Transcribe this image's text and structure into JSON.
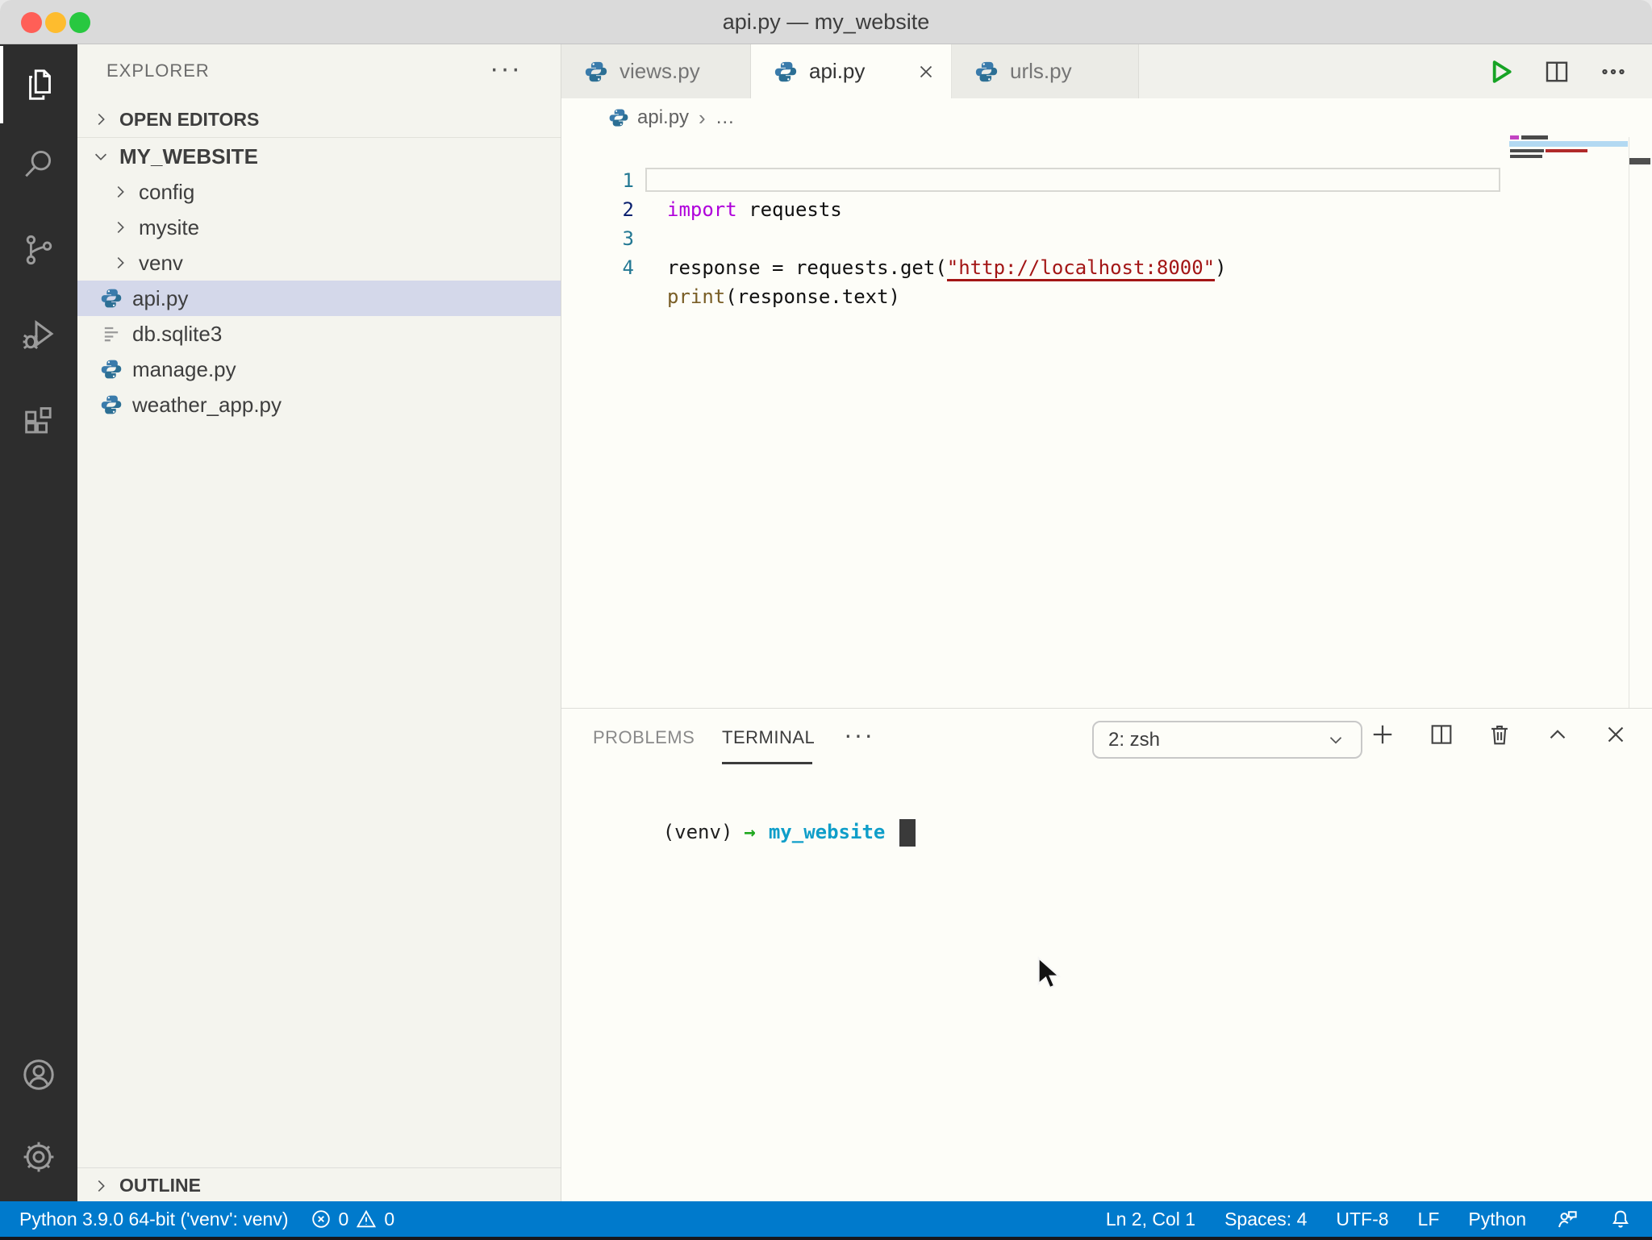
{
  "window": {
    "title": "api.py — my_website"
  },
  "colors": {
    "status_bar": "#007acc",
    "activity_bar": "#2d2d2d",
    "sidebar_bg": "#f4f4ee",
    "selection_bg": "#d4d8ea",
    "keyword": "#af00db",
    "string": "#a31515",
    "function": "#795e26",
    "line_number": "#237893",
    "active_line_number": "#0b216f",
    "terminal_cwd": "#0f9ec9",
    "terminal_arrow": "#1fa81f",
    "run_button": "#16a324"
  },
  "activity_bar": {
    "icons": [
      "files-icon",
      "search-icon",
      "source-control-icon",
      "run-debug-icon",
      "extensions-icon",
      "account-icon",
      "settings-gear-icon"
    ]
  },
  "sidebar": {
    "title": "EXPLORER",
    "more_label": "···",
    "open_editors_label": "OPEN EDITORS",
    "root_label": "MY_WEBSITE",
    "outline_label": "OUTLINE",
    "tree": [
      {
        "label": "config",
        "type": "folder"
      },
      {
        "label": "mysite",
        "type": "folder"
      },
      {
        "label": "venv",
        "type": "folder"
      },
      {
        "label": "api.py",
        "type": "python-file",
        "selected": true
      },
      {
        "label": "db.sqlite3",
        "type": "file"
      },
      {
        "label": "manage.py",
        "type": "python-file"
      },
      {
        "label": "weather_app.py",
        "type": "python-file"
      }
    ]
  },
  "editor_tabs": [
    {
      "label": "views.py",
      "active": false
    },
    {
      "label": "api.py",
      "active": true
    },
    {
      "label": "urls.py",
      "active": false
    }
  ],
  "breadcrumb": {
    "file": "api.py",
    "separator": "›",
    "more": "…"
  },
  "editor": {
    "lines": [
      {
        "num": "1",
        "tokens": [
          {
            "t": "import"
          },
          {
            "t": " requests"
          }
        ]
      },
      {
        "num": "2",
        "tokens": [],
        "current": true
      },
      {
        "num": "3",
        "tokens": [
          {
            "t": "response = requests.get("
          },
          {
            "t": "\"http://localhost:8000\""
          },
          {
            "t": ")"
          }
        ]
      },
      {
        "num": "4",
        "tokens": [
          {
            "t": "print"
          },
          {
            "t": "(response.text)"
          }
        ]
      }
    ]
  },
  "panel": {
    "tabs": [
      {
        "label": "PROBLEMS",
        "active": false
      },
      {
        "label": "TERMINAL",
        "active": true
      }
    ],
    "more_label": "···",
    "shell_selector": "2: zsh",
    "terminal": {
      "venv": "(venv)",
      "arrow": "→",
      "cwd": "my_website"
    }
  },
  "status_bar": {
    "interpreter": "Python 3.9.0 64-bit ('venv': venv)",
    "errors": "0",
    "warnings": "0",
    "cursor_position": "Ln 2, Col 1",
    "indentation": "Spaces: 4",
    "encoding": "UTF-8",
    "eol": "LF",
    "language": "Python"
  }
}
